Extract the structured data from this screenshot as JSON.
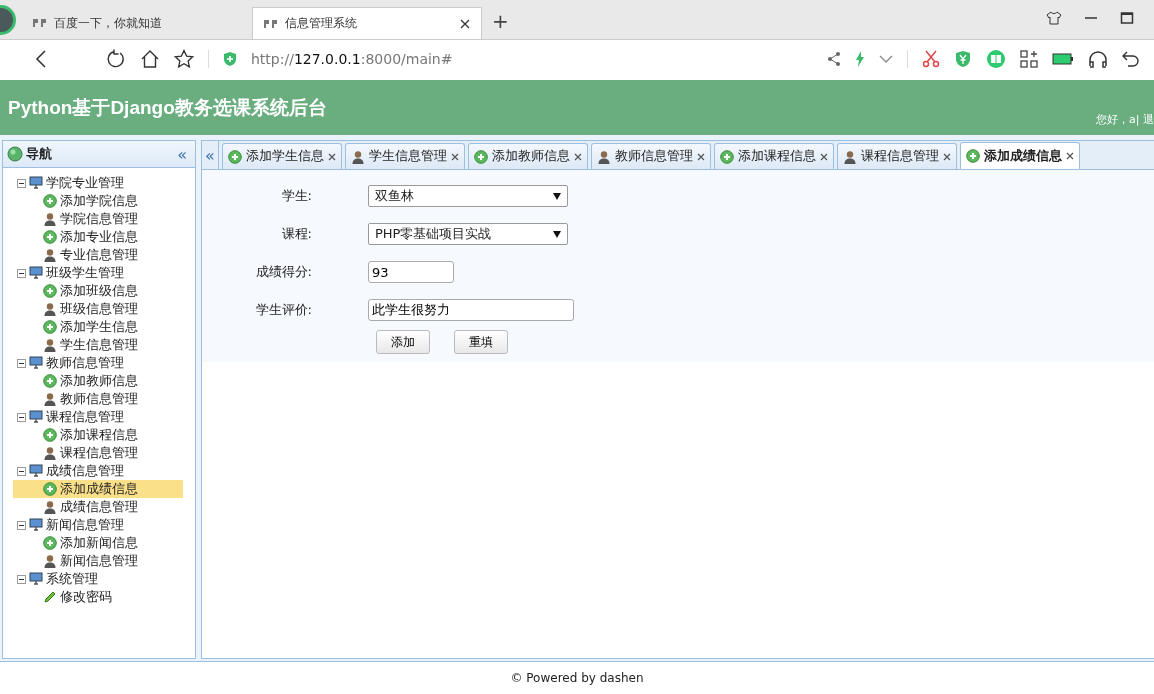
{
  "browser": {
    "tabs": [
      {
        "title": "百度一下，你就知道",
        "selected": false
      },
      {
        "title": "信息管理系统",
        "selected": true
      }
    ],
    "new_tab": "+",
    "address": {
      "host": "127.0.0.1",
      "rest": ":8000/main#",
      "scheme": "http://"
    }
  },
  "header": {
    "title": "Python基于Django教务选课系统后台",
    "greeting": "您好，a| 退"
  },
  "sidebar": {
    "title": "导航",
    "collapse": "«",
    "tree": [
      {
        "label": "学院专业管理",
        "expanded": true,
        "children": [
          {
            "label": "添加学院信息",
            "kind": "add",
            "selected": false
          },
          {
            "label": "学院信息管理",
            "kind": "manage",
            "selected": false
          },
          {
            "label": "添加专业信息",
            "kind": "add",
            "selected": false
          },
          {
            "label": "专业信息管理",
            "kind": "manage",
            "selected": false
          }
        ]
      },
      {
        "label": "班级学生管理",
        "expanded": true,
        "children": [
          {
            "label": "添加班级信息",
            "kind": "add",
            "selected": false
          },
          {
            "label": "班级信息管理",
            "kind": "manage",
            "selected": false
          },
          {
            "label": "添加学生信息",
            "kind": "add",
            "selected": false
          },
          {
            "label": "学生信息管理",
            "kind": "manage",
            "selected": false
          }
        ]
      },
      {
        "label": "教师信息管理",
        "expanded": true,
        "children": [
          {
            "label": "添加教师信息",
            "kind": "add",
            "selected": false
          },
          {
            "label": "教师信息管理",
            "kind": "manage",
            "selected": false
          }
        ]
      },
      {
        "label": "课程信息管理",
        "expanded": true,
        "children": [
          {
            "label": "添加课程信息",
            "kind": "add",
            "selected": false
          },
          {
            "label": "课程信息管理",
            "kind": "manage",
            "selected": false
          }
        ]
      },
      {
        "label": "成绩信息管理",
        "expanded": true,
        "children": [
          {
            "label": "添加成绩信息",
            "kind": "add",
            "selected": true
          },
          {
            "label": "成绩信息管理",
            "kind": "manage",
            "selected": false
          }
        ]
      },
      {
        "label": "新闻信息管理",
        "expanded": true,
        "children": [
          {
            "label": "添加新闻信息",
            "kind": "add",
            "selected": false
          },
          {
            "label": "新闻信息管理",
            "kind": "manage",
            "selected": false
          }
        ]
      },
      {
        "label": "系统管理",
        "expanded": true,
        "children": [
          {
            "label": "修改密码",
            "kind": "edit",
            "selected": false
          }
        ]
      }
    ]
  },
  "tab_scroll": "«",
  "tabs": [
    {
      "label": "添加学生信息",
      "kind": "add",
      "selected": false
    },
    {
      "label": "学生信息管理",
      "kind": "manage",
      "selected": false
    },
    {
      "label": "添加教师信息",
      "kind": "add",
      "selected": false
    },
    {
      "label": "教师信息管理",
      "kind": "manage",
      "selected": false
    },
    {
      "label": "添加课程信息",
      "kind": "add",
      "selected": false
    },
    {
      "label": "课程信息管理",
      "kind": "manage",
      "selected": false
    },
    {
      "label": "添加成绩信息",
      "kind": "add",
      "selected": true
    }
  ],
  "form": {
    "fields": [
      {
        "label": "学生:",
        "kind": "select",
        "value": "双鱼林"
      },
      {
        "label": "课程:",
        "kind": "select",
        "value": "PHP零基础项目实战"
      },
      {
        "label": "成绩得分:",
        "kind": "input",
        "value": "93"
      },
      {
        "label": "学生评价:",
        "kind": "text",
        "value": "此学生很努力"
      }
    ],
    "buttons": [
      "添加",
      "重填"
    ]
  },
  "footer": "© Powered by dashen"
}
